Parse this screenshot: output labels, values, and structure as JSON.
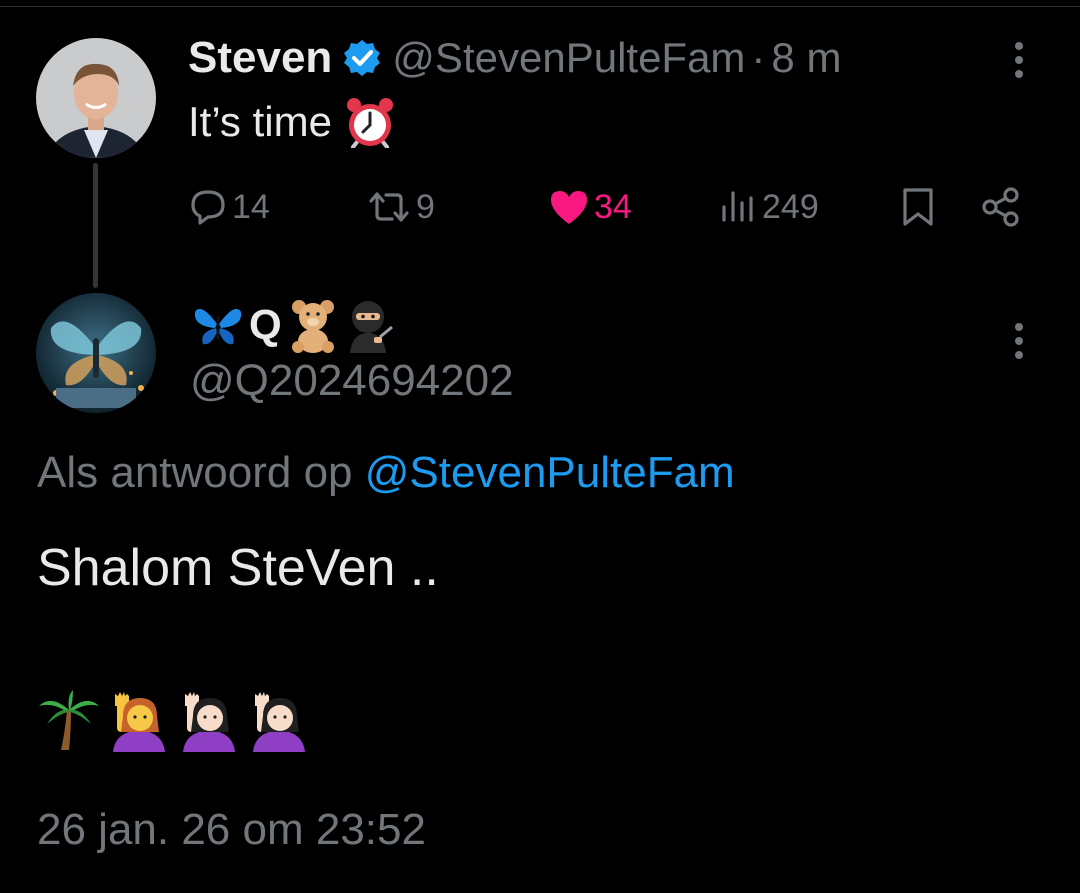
{
  "tweet": {
    "author_name": "Steven",
    "handle": "@StevenPulteFam",
    "separator": "·",
    "time_ago": "8 m",
    "text": "It’s time",
    "emoji_icon": "alarm-clock-icon",
    "stats": {
      "replies": "14",
      "retweets": "9",
      "likes": "34",
      "views": "249"
    },
    "like_color": "#f91880",
    "verified_color": "#1d9bf0"
  },
  "reply": {
    "display_name_text": "Q",
    "display_name_icons": [
      "butterfly-icon",
      "teddy-bear-icon",
      "ninja-icon"
    ],
    "handle": "@Q2024694202",
    "replying_to_prefix": "Als antwoord op",
    "replying_to_handle": "@StevenPulteFam",
    "text": "Shalom SteVen ..",
    "emoji_icons": [
      "palm-tree-icon",
      "woman-raising-hand-icon",
      "woman-raising-hand-icon",
      "woman-raising-hand-icon"
    ],
    "timestamp": "26 jan. 26 om 23:52"
  },
  "colors": {
    "background": "#000000",
    "text": "#e7e9ea",
    "secondary": "#71767b",
    "link": "#1d9bf0"
  }
}
